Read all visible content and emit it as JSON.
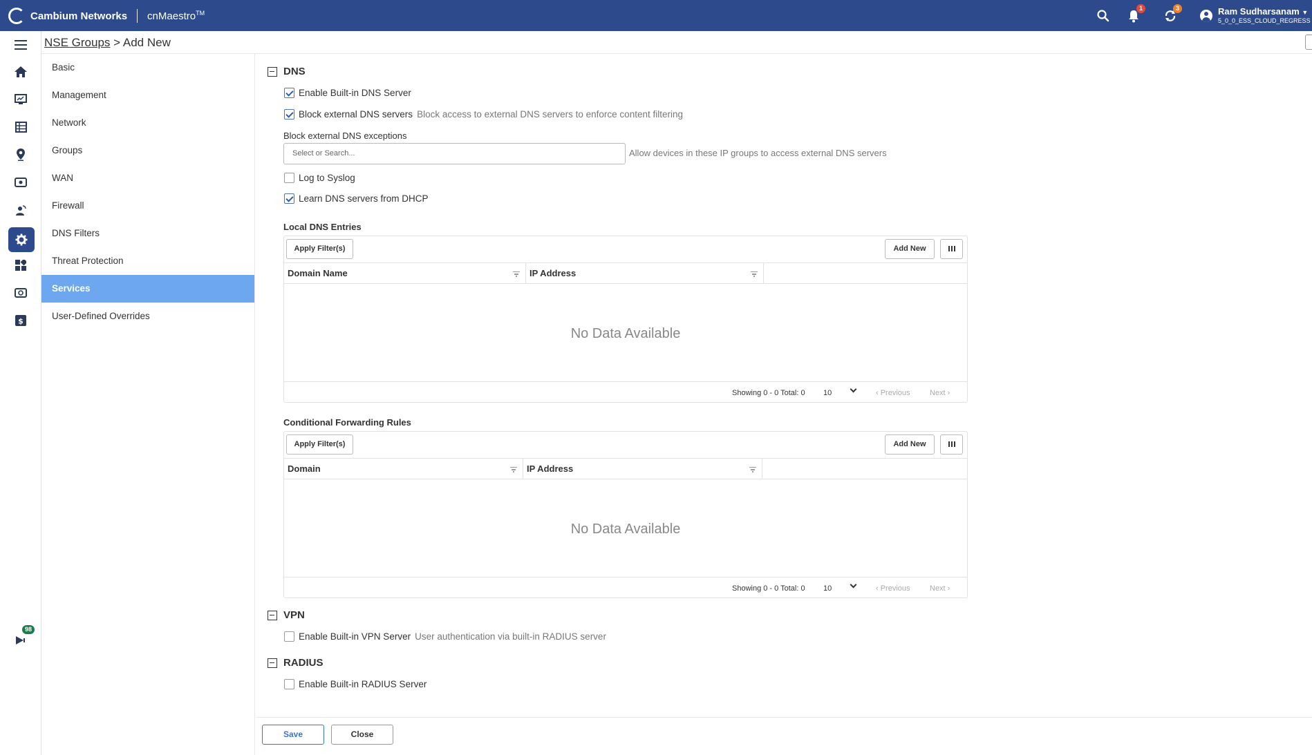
{
  "header": {
    "brand": "Cambium Networks",
    "product": "cnMaestro",
    "product_mark": "TM",
    "notifications_count": "1",
    "tasks_count": "3",
    "user_name": "Ram Sudharsanam",
    "user_account": "5_0_0_ESS_CLOUD_REGRESS"
  },
  "rail": {
    "feedback_count": "98"
  },
  "breadcrumb": {
    "parent": "NSE Groups",
    "separator": " > ",
    "current": "Add New"
  },
  "subnav": {
    "items": [
      {
        "label": "Basic"
      },
      {
        "label": "Management"
      },
      {
        "label": "Network"
      },
      {
        "label": "Groups"
      },
      {
        "label": "WAN"
      },
      {
        "label": "Firewall"
      },
      {
        "label": "DNS Filters"
      },
      {
        "label": "Threat Protection"
      },
      {
        "label": "Services",
        "active": true
      },
      {
        "label": "User-Defined Overrides"
      }
    ]
  },
  "dns": {
    "title": "DNS",
    "enable_builtin": {
      "label": "Enable Built-in DNS Server",
      "checked": true
    },
    "block_external": {
      "label": "Block external DNS servers",
      "hint": "Block access to external DNS servers to enforce content filtering",
      "checked": true
    },
    "exceptions_label": "Block external DNS exceptions",
    "exceptions_placeholder": "Select or Search...",
    "exceptions_hint": "Allow devices in these IP groups to access external DNS servers",
    "log_syslog": {
      "label": "Log to Syslog",
      "checked": false
    },
    "learn_dhcp": {
      "label": "Learn DNS servers from DHCP",
      "checked": true
    },
    "local_entries": {
      "title": "Local DNS Entries",
      "apply_filter": "Apply Filter(s)",
      "add_new": "Add New",
      "columns": [
        "Domain Name",
        "IP Address"
      ],
      "no_data": "No Data Available",
      "showing": "Showing 0 - 0 Total: 0",
      "page_size": "10",
      "previous": "‹ Previous",
      "next": "Next ›"
    },
    "forwarding_rules": {
      "title": "Conditional Forwarding Rules",
      "apply_filter": "Apply Filter(s)",
      "add_new": "Add New",
      "columns": [
        "Domain",
        "IP Address"
      ],
      "no_data": "No Data Available",
      "showing": "Showing 0 - 0 Total: 0",
      "page_size": "10",
      "previous": "‹ Previous",
      "next": "Next ›"
    }
  },
  "vpn": {
    "title": "VPN",
    "enable_builtin": {
      "label": "Enable Built-in VPN Server",
      "hint": "User authentication via built-in RADIUS server",
      "checked": false
    }
  },
  "radius": {
    "title": "RADIUS",
    "enable_builtin": {
      "label": "Enable Built-in RADIUS Server",
      "checked": false
    }
  },
  "footer": {
    "save": "Save",
    "close": "Close"
  },
  "colors": {
    "header_bg": "#2c4a8c",
    "active_nav": "#6ca7ef",
    "primary": "#3d73c9"
  }
}
